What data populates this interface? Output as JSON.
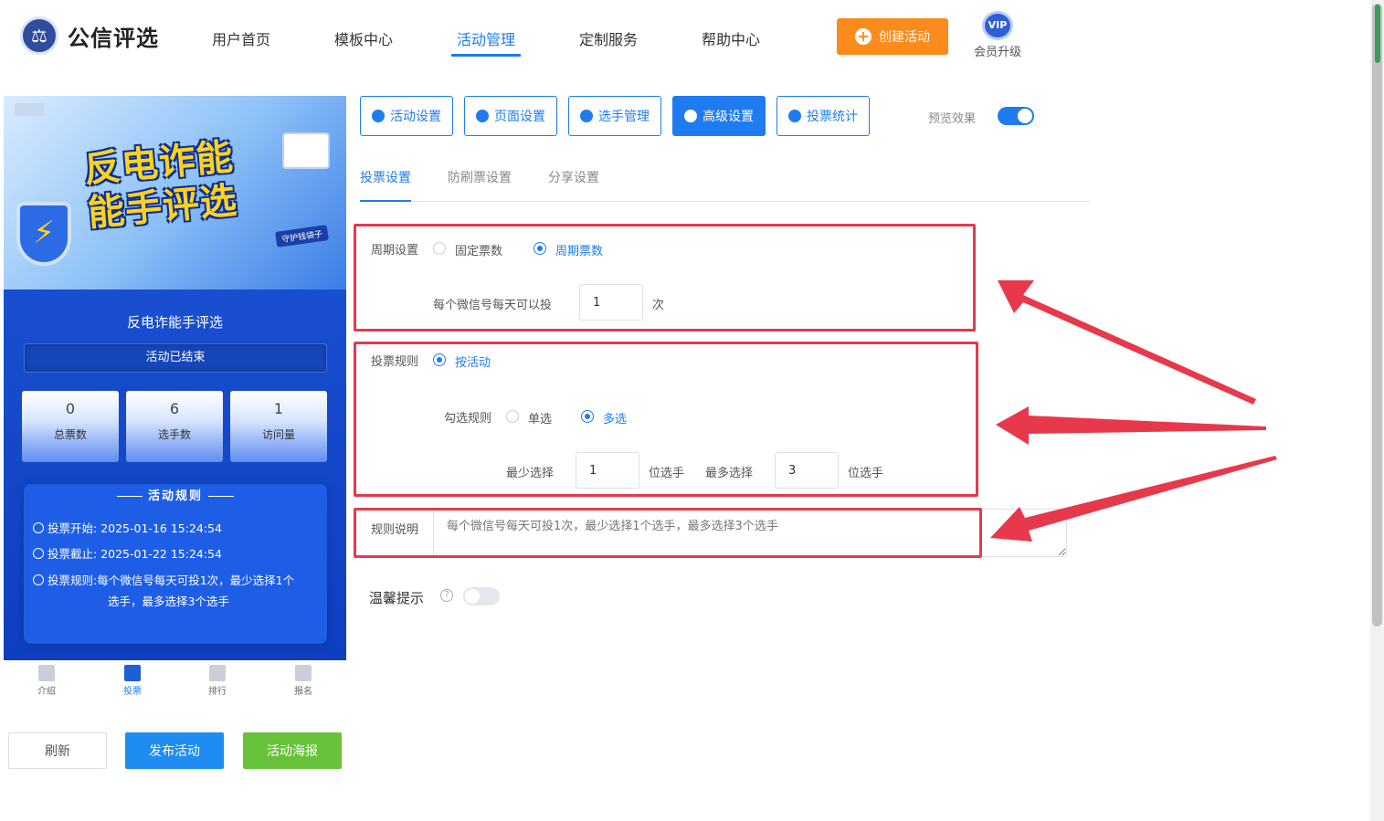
{
  "header": {
    "logo_icon": "scales-of-justice-icon",
    "logo_text": "公信评选",
    "nav": [
      "用户首页",
      "模板中心",
      "活动管理",
      "定制服务",
      "帮助中心"
    ],
    "active_nav": "活动管理",
    "create_button": "创建活动",
    "vip_badge": "VIP",
    "vip_label": "会员升级"
  },
  "preview": {
    "banner_title_line1": "反电诈能",
    "banner_title_line2": "能手评选",
    "banner_tag": "守护钱袋子",
    "activity_title": "反电诈能手评选",
    "status": "活动已结束",
    "stats": [
      {
        "value": "0",
        "label": "总票数"
      },
      {
        "value": "6",
        "label": "选手数"
      },
      {
        "value": "1",
        "label": "访问量"
      }
    ],
    "rules_heading": "活动规则",
    "vote_start_label": "投票开始:",
    "vote_start": "2025-01-16 15:24:54",
    "vote_end_label": "投票截止:",
    "vote_end": "2025-01-22 15:24:54",
    "vote_rule_label": "投票规则:",
    "vote_rule_line1": "每个微信号每天可投1次，最少选择1个",
    "vote_rule_line2": "选手，最多选择3个选手",
    "tabs": [
      {
        "label": "介绍",
        "icon": "bookmark-icon"
      },
      {
        "label": "投票",
        "icon": "vote-check-icon"
      },
      {
        "label": "排行",
        "icon": "crown-icon"
      },
      {
        "label": "报名",
        "icon": "flag-icon"
      }
    ],
    "active_tab": "投票"
  },
  "actions": {
    "refresh": "刷新",
    "publish": "发布活动",
    "poster": "活动海报"
  },
  "toolbar": {
    "buttons": [
      {
        "label": "活动设置",
        "icon": "star-icon"
      },
      {
        "label": "页面设置",
        "icon": "gear-icon"
      },
      {
        "label": "选手管理",
        "icon": "users-icon"
      },
      {
        "label": "高级设置",
        "icon": "sliders-icon"
      },
      {
        "label": "投票统计",
        "icon": "bar-chart-icon"
      }
    ],
    "active": "高级设置",
    "preview_label": "预览效果",
    "preview_on": true
  },
  "subtabs": {
    "items": [
      "投票设置",
      "防刷票设置",
      "分享设置"
    ],
    "active": "投票设置"
  },
  "form": {
    "cycle_label": "周期设置",
    "cycle_options": [
      "固定票数",
      "周期票数"
    ],
    "cycle_selected": "周期票数",
    "daily_label": "每个微信号每天可以投",
    "daily_value": "1",
    "daily_unit": "次",
    "rule_label": "投票规则",
    "rule_option": "按活动",
    "select_rule_label": "勾选规则",
    "select_options": [
      "单选",
      "多选"
    ],
    "select_selected": "多选",
    "min_label": "最少选择",
    "min_value": "1",
    "min_unit": "位选手",
    "max_label": "最多选择",
    "max_value": "3",
    "max_unit": "位选手",
    "desc_label": "规则说明",
    "desc_placeholder": "每个微信号每天可投1次，最少选择1个选手，最多选择3个选手",
    "tip_label": "温馨提示",
    "tip_on": false
  },
  "colors": {
    "accent": "#1e7cf0",
    "orange": "#fb8b1c",
    "green": "#67c23a",
    "annotation_red": "#e8384b"
  }
}
